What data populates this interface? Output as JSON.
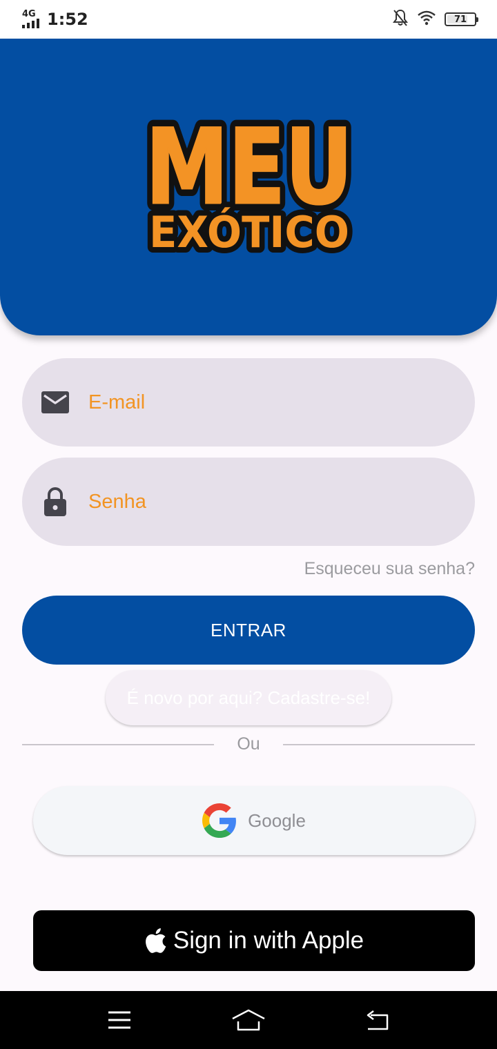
{
  "status_bar": {
    "network": "4G",
    "time": "1:52",
    "battery": "71",
    "icons": [
      "signal-icon",
      "silent-notification-icon",
      "wifi-icon",
      "battery-icon"
    ]
  },
  "header": {
    "logo_line1": "MEU",
    "logo_line2": "EXÓTICO",
    "background_color": "#034ea2",
    "logo_color": "#f39325"
  },
  "login_form": {
    "email": {
      "placeholder": "E-mail",
      "value": "",
      "icon": "mail-icon"
    },
    "password": {
      "placeholder": "Senha",
      "value": "",
      "icon": "lock-icon"
    },
    "forgot_password": "Esqueceu sua senha?",
    "enter_button": "ENTRAR",
    "signup_button": "É novo por aqui? Cadastre-se!"
  },
  "divider": {
    "label": "Ou"
  },
  "social": {
    "google_label": "Google",
    "apple_label": "Sign in with Apple"
  },
  "colors": {
    "primary": "#034ea2",
    "accent": "#f29423",
    "field_bg": "#e6e0ea"
  },
  "nav_bar": {
    "buttons": [
      "menu-icon",
      "home-icon",
      "back-icon"
    ]
  }
}
